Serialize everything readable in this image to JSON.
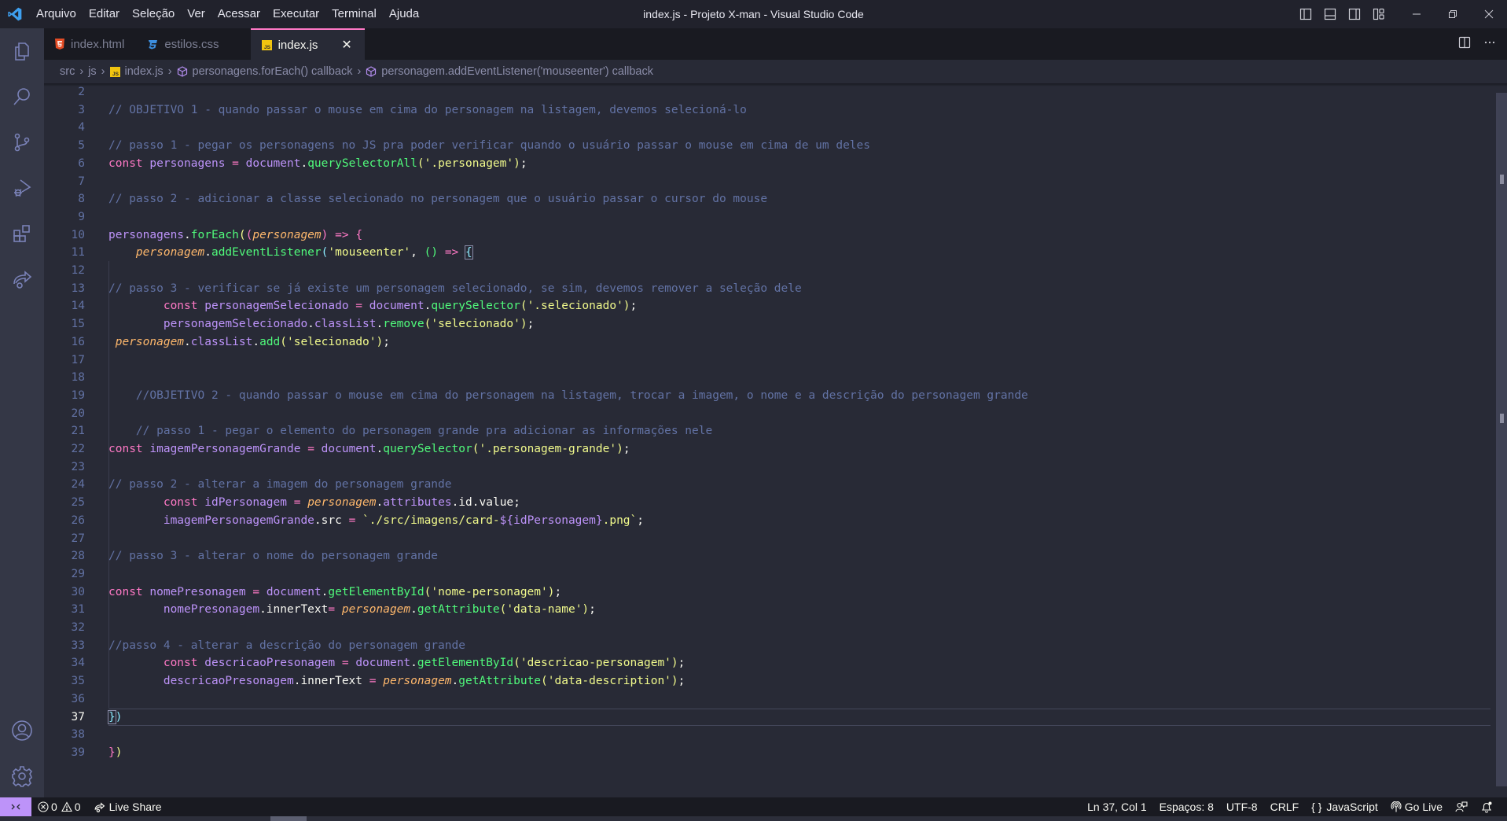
{
  "titlebar": {
    "menu": [
      "Arquivo",
      "Editar",
      "Seleção",
      "Ver",
      "Acessar",
      "Executar",
      "Terminal",
      "Ajuda"
    ],
    "window_title": "index.js - Projeto X-man - Visual Studio Code",
    "controls": [
      "toggle-primary-sidebar",
      "toggle-panel",
      "toggle-secondary-sidebar",
      "customize-layout",
      "minimize",
      "restore",
      "close"
    ]
  },
  "activitybar": {
    "items": [
      "Explorer",
      "Search",
      "Source Control",
      "Run and Debug",
      "Extensions",
      "Live Share"
    ],
    "bottom": [
      "Accounts",
      "Manage"
    ]
  },
  "tabs": [
    {
      "label": "index.html",
      "icon": "html5-icon",
      "color": "#e44d26",
      "active": false
    },
    {
      "label": "estilos.css",
      "icon": "css3-icon",
      "color": "#3d8fe0",
      "active": false
    },
    {
      "label": "index.js",
      "icon": "js-icon",
      "color": "#f1c40f",
      "active": true,
      "close": "✕"
    }
  ],
  "breadcrumb": {
    "items": [
      "src",
      "js",
      "index.js",
      "personagens.forEach() callback",
      "personagem.addEventListener('mouseenter') callback"
    ]
  },
  "editor": {
    "language": "javascript",
    "current_line": 37,
    "lines": [
      {
        "n": "2",
        "html": ""
      },
      {
        "n": "3",
        "html": "<span class='c'>// OBJETIVO 1 - quando passar o mouse em cima do personagem na listagem, devemos selecioná-lo</span>"
      },
      {
        "n": "4",
        "html": ""
      },
      {
        "n": "5",
        "html": "<span class='c'>// passo 1 - pegar os personagens no JS pra poder verificar quando o usuário passar o mouse em cima de um deles</span>"
      },
      {
        "n": "6",
        "html": "<span class='k'>const</span> <span class='v'>personagens</span> <span class='o'>=</span> <span class='v'>document</span>.<span class='f'>querySelectorAll</span><span class='br1'>(</span><span class='s'>'.personagem'</span><span class='br1'>)</span>;"
      },
      {
        "n": "7",
        "html": ""
      },
      {
        "n": "8",
        "html": "<span class='c'>// passo 2 - adicionar a classe selecionado no personagem que o usuário passar o cursor do mouse</span>"
      },
      {
        "n": "9",
        "html": ""
      },
      {
        "n": "10",
        "html": "<span class='v'>personagens</span>.<span class='f'>forEach</span><span class='br1'>(</span><span class='br2'>(</span><span class='p'>personagem</span><span class='br2'>)</span> <span class='o'>=&gt;</span> <span class='br2'>{</span>"
      },
      {
        "n": "11",
        "html": "    <span class='p'>personagem</span>.<span class='f'>addEventListener</span><span class='br3'>(</span><span class='s'>'mouseenter'</span>, <span class='f'>()</span> <span class='o'>=&gt;</span> <span class='br3 bmatch'>{</span>"
      },
      {
        "n": "12",
        "html": ""
      },
      {
        "n": "13",
        "html": "<span class='c'>// passo 3 - verificar se já existe um personagem selecionado, se sim, devemos remover a seleção dele</span>"
      },
      {
        "n": "14",
        "html": "        <span class='k'>const</span> <span class='v'>personagemSelecionado</span> <span class='o'>=</span> <span class='v'>document</span>.<span class='f'>querySelector</span><span class='br1'>(</span><span class='s'>'.selecionado'</span><span class='br1'>)</span>;"
      },
      {
        "n": "15",
        "html": "        <span class='v'>personagemSelecionado</span>.<span class='v'>classList</span>.<span class='f'>remove</span><span class='br1'>(</span><span class='s'>'selecionado'</span><span class='br1'>)</span>;"
      },
      {
        "n": "16",
        "html": " <span class='p'>personagem</span>.<span class='v'>classList</span>.<span class='f'>add</span><span class='br1'>(</span><span class='s'>'selecionado'</span><span class='br1'>)</span>;"
      },
      {
        "n": "17",
        "html": ""
      },
      {
        "n": "18",
        "html": ""
      },
      {
        "n": "19",
        "html": "    <span class='c'>//OBJETIVO 2 - quando passar o mouse em cima do personagem na listagem, trocar a imagem, o nome e a descrição do personagem grande</span>"
      },
      {
        "n": "20",
        "html": ""
      },
      {
        "n": "21",
        "html": "    <span class='c'>// passo 1 - pegar o elemento do personagem grande pra adicionar as informações nele</span>"
      },
      {
        "n": "22",
        "html": "<span class='k'>const</span> <span class='v'>imagemPersonagemGrande</span> <span class='o'>=</span> <span class='v'>document</span>.<span class='f'>querySelector</span><span class='br1'>(</span><span class='s'>'.personagem-grande'</span><span class='br1'>)</span>;"
      },
      {
        "n": "23",
        "html": ""
      },
      {
        "n": "24",
        "html": "<span class='c'>// passo 2 - alterar a imagem do personagem grande</span>"
      },
      {
        "n": "25",
        "html": "        <span class='k'>const</span> <span class='v'>idPersonagem</span> <span class='o'>=</span> <span class='p'>personagem</span>.<span class='v'>attributes</span>.<span class='w'>id</span>.<span class='w'>value</span>;"
      },
      {
        "n": "26",
        "html": "        <span class='v'>imagemPersonagemGrande</span>.<span class='w'>src</span> <span class='o'>=</span> <span class='s'>`./src/imagens/card-</span><span class='v'>${idPersonagem}</span><span class='s'>.png`</span>;"
      },
      {
        "n": "27",
        "html": ""
      },
      {
        "n": "28",
        "html": "<span class='c'>// passo 3 - alterar o nome do personagem grande</span>"
      },
      {
        "n": "29",
        "html": ""
      },
      {
        "n": "30",
        "html": "<span class='k'>const</span> <span class='v'>nomePresonagem</span> <span class='o'>=</span> <span class='v'>document</span>.<span class='f'>getElementById</span><span class='br1'>(</span><span class='s'>'nome-personagem'</span><span class='br1'>)</span>;"
      },
      {
        "n": "31",
        "html": "        <span class='v'>nomePresonagem</span>.<span class='w'>innerText</span><span class='o'>=</span> <span class='p'>personagem</span>.<span class='f'>getAttribute</span><span class='br1'>(</span><span class='s'>'data-name'</span><span class='br1'>)</span>;"
      },
      {
        "n": "32",
        "html": ""
      },
      {
        "n": "33",
        "html": "<span class='c'>//passo 4 - alterar a descrição do personagem grande</span>"
      },
      {
        "n": "34",
        "html": "        <span class='k'>const</span> <span class='v'>descricaoPresonagem</span> <span class='o'>=</span> <span class='v'>document</span>.<span class='f'>getElementById</span><span class='br1'>(</span><span class='s'>'descricao-personagem'</span><span class='br1'>)</span>;"
      },
      {
        "n": "35",
        "html": "        <span class='v'>descricaoPresonagem</span>.<span class='w'>innerText</span> <span class='o'>=</span> <span class='p'>personagem</span>.<span class='f'>getAttribute</span><span class='br1'>(</span><span class='s'>'data-description'</span><span class='br1'>)</span>;"
      },
      {
        "n": "36",
        "html": ""
      },
      {
        "n": "37",
        "html": "<span class='br3 bmatch'>}</span><span class='br3'>)</span>"
      },
      {
        "n": "38",
        "html": ""
      },
      {
        "n": "39",
        "html": "<span class='br2'>}</span><span class='br1'>)</span>"
      }
    ]
  },
  "statusbar": {
    "errors": "0",
    "warnings": "0",
    "live_share": "Live Share",
    "position": "Ln 37, Col 1",
    "indent": "Espaços: 8",
    "encoding": "UTF-8",
    "eol": "CRLF",
    "language_icon": "{ }",
    "language": "JavaScript",
    "go_live": "Go Live"
  }
}
